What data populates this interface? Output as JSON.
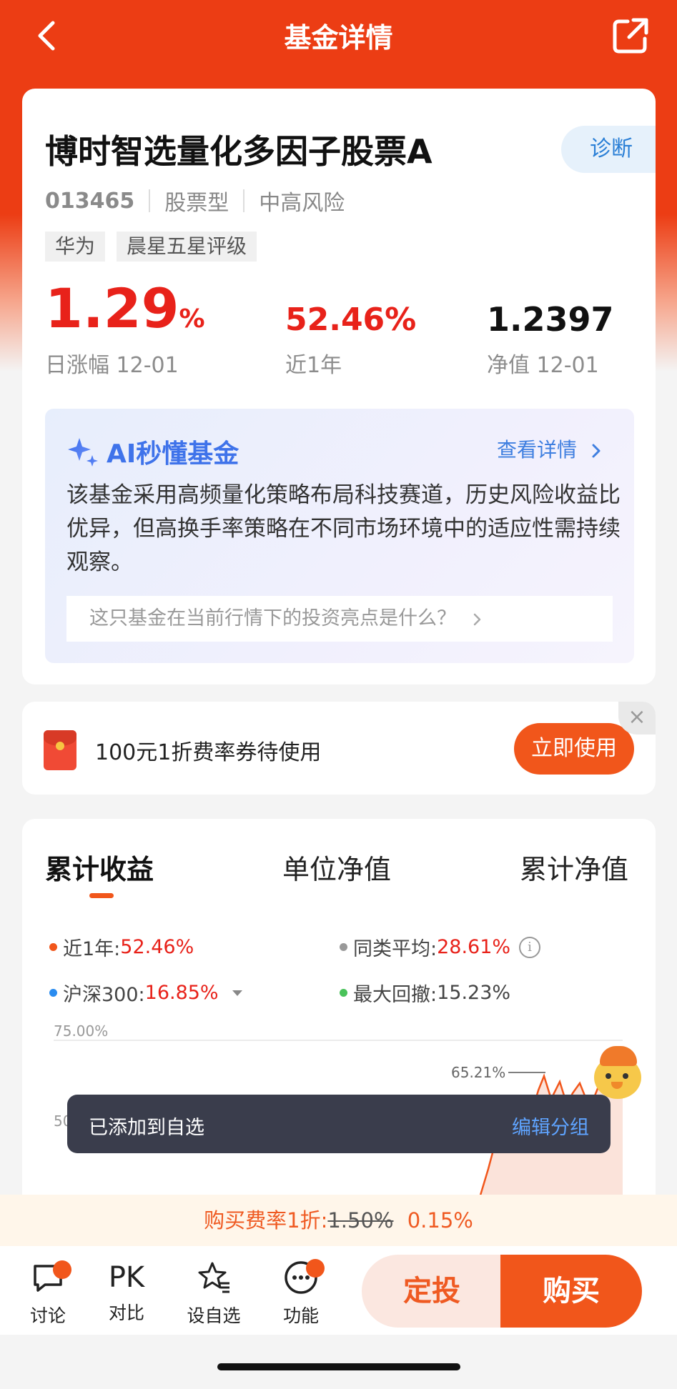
{
  "nav": {
    "title": "基金详情"
  },
  "fund": {
    "name": "博时智选量化多因子股票A",
    "diagnose_label": "诊断",
    "code": "013465",
    "type": "股票型",
    "risk": "中高风险",
    "tags": [
      "华为",
      "晨星五星评级"
    ],
    "daily_change_value": "1.29",
    "daily_change_unit": "%",
    "daily_change_label": "日涨幅 12-01",
    "year_return": "52.46%",
    "year_return_label": "近1年",
    "nav_value": "1.2397",
    "nav_label": "净值 12-01"
  },
  "ai": {
    "title": "AI秒懂基金",
    "detail_link": "查看详情",
    "summary": "该基金采用高频量化策略布局科技赛道，历史风险收益比优异，但高换手率策略在不同市场环境中的适应性需持续观察。",
    "question": "这只基金在当前行情下的投资亮点是什么？"
  },
  "coupon": {
    "text": "100元1折费率券待使用",
    "button": "立即使用",
    "close": "×"
  },
  "chart_tabs": [
    "累计收益",
    "单位净值",
    "累计净值"
  ],
  "legend": {
    "near_year_label": "近1年:",
    "near_year_value": "52.46%",
    "peer_avg_label": "同类平均:",
    "peer_avg_value": "28.61%",
    "hs300_label": "沪深300:",
    "hs300_value": "16.85%",
    "max_drawdown_label": "最大回撤:",
    "max_drawdown_value": "15.23%",
    "colors": {
      "near_year": "#f1561b",
      "peer_avg": "#999999",
      "hs300": "#2a8cf0",
      "max_drawdown": "#49c25a"
    }
  },
  "chart": {
    "y_top_label": "75.00%",
    "y_mid_label": "50",
    "peak_label": "65.21%"
  },
  "toast": {
    "text": "已添加到自选",
    "link": "编辑分组"
  },
  "fee": {
    "label": "购买费率1折:",
    "original": "1.50%",
    "discounted": "0.15%"
  },
  "bottom": {
    "items": [
      {
        "label": "讨论",
        "icon": "chat-icon"
      },
      {
        "label": "对比",
        "icon": "PK"
      },
      {
        "label": "设自选",
        "icon": "star-list-icon"
      },
      {
        "label": "功能",
        "icon": "more-icon"
      }
    ],
    "dingtou": "定投",
    "buy": "购买"
  }
}
